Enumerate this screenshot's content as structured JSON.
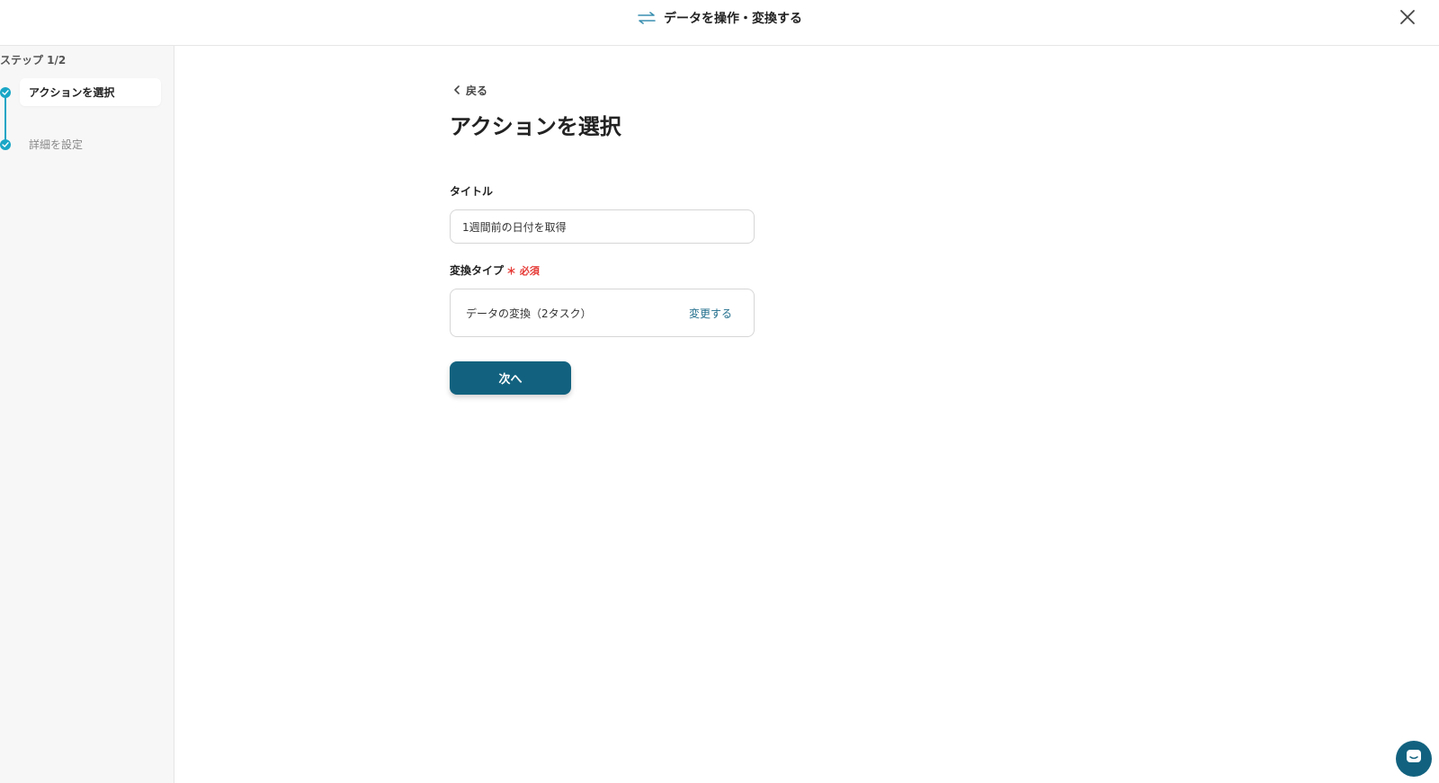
{
  "header": {
    "title": "データを操作・変換する",
    "title_icon": "swap-arrows-icon",
    "close_icon": "close-icon"
  },
  "sidebar": {
    "step_counter": "ステップ 1/2",
    "steps": [
      {
        "label": "アクションを選択",
        "active": true,
        "icon": "check-icon"
      },
      {
        "label": "詳細を設定",
        "active": false,
        "icon": "check-icon"
      }
    ]
  },
  "main": {
    "back_label": "戻る",
    "page_title": "アクションを選択",
    "title_field": {
      "label": "タイトル",
      "value": "1週間前の日付を取得"
    },
    "type_field": {
      "label": "変換タイプ",
      "required_label": "必須",
      "value": "データの変換（2タスク）",
      "change_label": "変更する"
    },
    "next_label": "次へ"
  },
  "chat": {
    "icon": "chat-icon"
  },
  "colors": {
    "accent": "#12627f",
    "step": "#1aa6c6",
    "required": "#e53935",
    "link": "#1f6d8c"
  }
}
